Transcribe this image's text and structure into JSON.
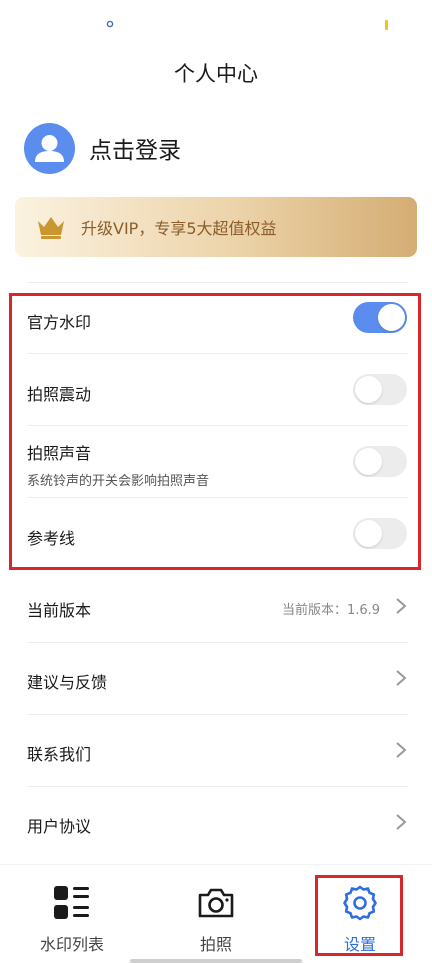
{
  "header": {
    "title": "个人中心"
  },
  "profile": {
    "login_label": "点击登录"
  },
  "vip": {
    "text": "升级VIP，专享5大超值权益"
  },
  "settings": [
    {
      "label": "官方水印",
      "on": true
    },
    {
      "label": "拍照震动",
      "on": false
    },
    {
      "label": "拍照声音",
      "sub": "系统铃声的开关会影响拍照声音",
      "on": false
    },
    {
      "label": "参考线",
      "on": false
    }
  ],
  "links": [
    {
      "label": "当前版本",
      "value": "当前版本：1.6.9"
    },
    {
      "label": "建议与反馈"
    },
    {
      "label": "联系我们"
    },
    {
      "label": "用户协议"
    }
  ],
  "tabs": [
    {
      "label": "水印列表",
      "icon": "grid-list-icon"
    },
    {
      "label": "拍照",
      "icon": "camera-icon"
    },
    {
      "label": "设置",
      "icon": "gear-icon",
      "active": true
    }
  ],
  "colors": {
    "accent": "#5b8def",
    "active_tab": "#2f6ee0",
    "highlight": "#d8262c",
    "vip_text": "#8a5d2b"
  }
}
